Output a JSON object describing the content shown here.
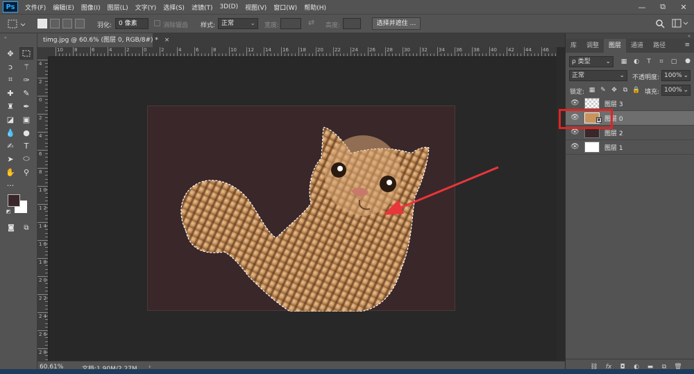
{
  "menubar": {
    "logo": "Ps",
    "items": [
      "文件(F)",
      "编辑(E)",
      "图像(I)",
      "图层(L)",
      "文字(Y)",
      "选择(S)",
      "滤镜(T)",
      "3D(D)",
      "视图(V)",
      "窗口(W)",
      "帮助(H)"
    ],
    "window_controls": [
      "—",
      "⧉",
      "✕"
    ]
  },
  "options": {
    "feather_label": "羽化:",
    "feather_value": "0 像素",
    "antialias_label": "消除锯齿",
    "style_label": "样式:",
    "style_value": "正常",
    "width_label": "宽度:",
    "height_label": "高度:",
    "select_mask_button": "选择并遮住 ..."
  },
  "document": {
    "tab_title": "timg.jpg @ 60.6% (图层 0, RGB/8#) *",
    "tab_close": "×",
    "zoom": "60.61%",
    "doc_info": "文档:1.90M/2.27M",
    "status_arrow": "›",
    "canvas_color": "#3a2729"
  },
  "ruler": {
    "h_labels": [
      "10",
      "8",
      "6",
      "4",
      "2",
      "0",
      "2",
      "4",
      "6",
      "8",
      "10",
      "12",
      "14",
      "16",
      "18",
      "20",
      "22",
      "24",
      "26",
      "28",
      "30",
      "32",
      "34",
      "36",
      "38",
      "40",
      "42",
      "44",
      "46"
    ],
    "v_labels": [
      "4",
      "2",
      "0",
      "2",
      "4",
      "6",
      "8",
      "1 0",
      "1 2",
      "1 4",
      "1 6",
      "1 8",
      "2 0",
      "2 2",
      "2 4",
      "2 6",
      "2 8"
    ]
  },
  "tools": {
    "foreground_color": "#3a2729",
    "background_color": "#ffffff"
  },
  "panels": {
    "tabs": [
      "库",
      "调整",
      "图层",
      "通道",
      "路径"
    ],
    "active_tab": "图层",
    "filter_label": "ρ 类型",
    "blend_mode": "正常",
    "opacity_label": "不透明度:",
    "opacity_value": "100%",
    "lock_label": "锁定:",
    "fill_label": "填充:",
    "fill_value": "100%",
    "layers": [
      {
        "name": "图层 3",
        "thumb": "transparent",
        "selected": false
      },
      {
        "name": "图层 0",
        "thumb": "cat",
        "selected": true
      },
      {
        "name": "图层 2",
        "thumb": "#3a2729",
        "selected": false
      },
      {
        "name": "图层 1",
        "thumb": "#ffffff",
        "selected": false
      }
    ],
    "bottom_icons": [
      "link-icon",
      "fx-icon",
      "mask-icon",
      "adjustment-icon",
      "group-icon",
      "new-layer-icon",
      "delete-icon"
    ]
  },
  "annotations": {
    "highlight_color": "#e02424",
    "arrow_color": "#e8363b"
  }
}
